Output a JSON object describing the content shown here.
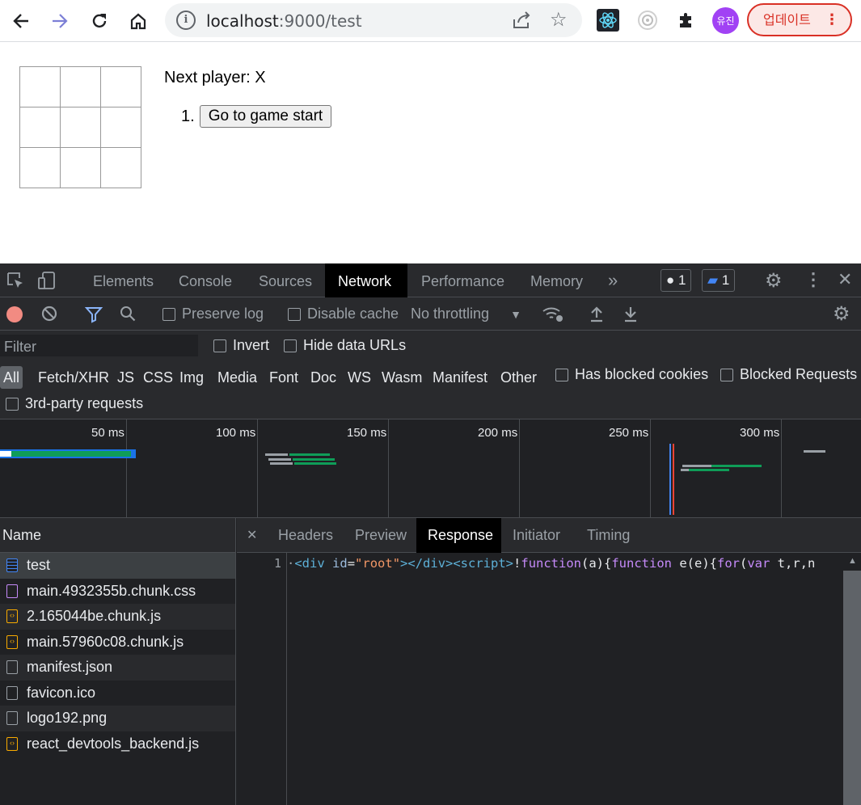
{
  "browser": {
    "url_host": "localhost",
    "url_rest": ":9000/test",
    "profile_label": "유진",
    "update_label": "업데이트"
  },
  "page": {
    "status": "Next player: X",
    "moves": [
      {
        "num": "1.",
        "label": "Go to game start"
      }
    ]
  },
  "devtools": {
    "tabs": [
      "Elements",
      "Console",
      "Sources",
      "Network",
      "Performance",
      "Memory"
    ],
    "active_tab": "Network",
    "warnings_count": "1",
    "messages_count": "1",
    "toolbar": {
      "preserve_log": "Preserve log",
      "disable_cache": "Disable cache",
      "throttling": "No throttling"
    },
    "filter": {
      "placeholder": "Filter",
      "invert": "Invert",
      "hide_data_urls": "Hide data URLs",
      "types": [
        "All",
        "Fetch/XHR",
        "JS",
        "CSS",
        "Img",
        "Media",
        "Font",
        "Doc",
        "WS",
        "Wasm",
        "Manifest",
        "Other"
      ],
      "has_blocked_cookies": "Has blocked cookies",
      "blocked_requests": "Blocked Requests",
      "third_party": "3rd-party requests"
    },
    "timeline_ticks": [
      "50 ms",
      "100 ms",
      "150 ms",
      "200 ms",
      "250 ms",
      "300 ms"
    ],
    "name_header": "Name",
    "requests": [
      {
        "name": "test",
        "type": "doc"
      },
      {
        "name": "main.4932355b.chunk.css",
        "type": "css"
      },
      {
        "name": "2.165044be.chunk.js",
        "type": "js"
      },
      {
        "name": "main.57960c08.chunk.js",
        "type": "js"
      },
      {
        "name": "manifest.json",
        "type": "other"
      },
      {
        "name": "favicon.ico",
        "type": "other"
      },
      {
        "name": "logo192.png",
        "type": "other"
      },
      {
        "name": "react_devtools_backend.js",
        "type": "js"
      }
    ],
    "detail_tabs": [
      "Headers",
      "Preview",
      "Response",
      "Initiator",
      "Timing"
    ],
    "active_detail_tab": "Response",
    "response_line_no": "1"
  }
}
